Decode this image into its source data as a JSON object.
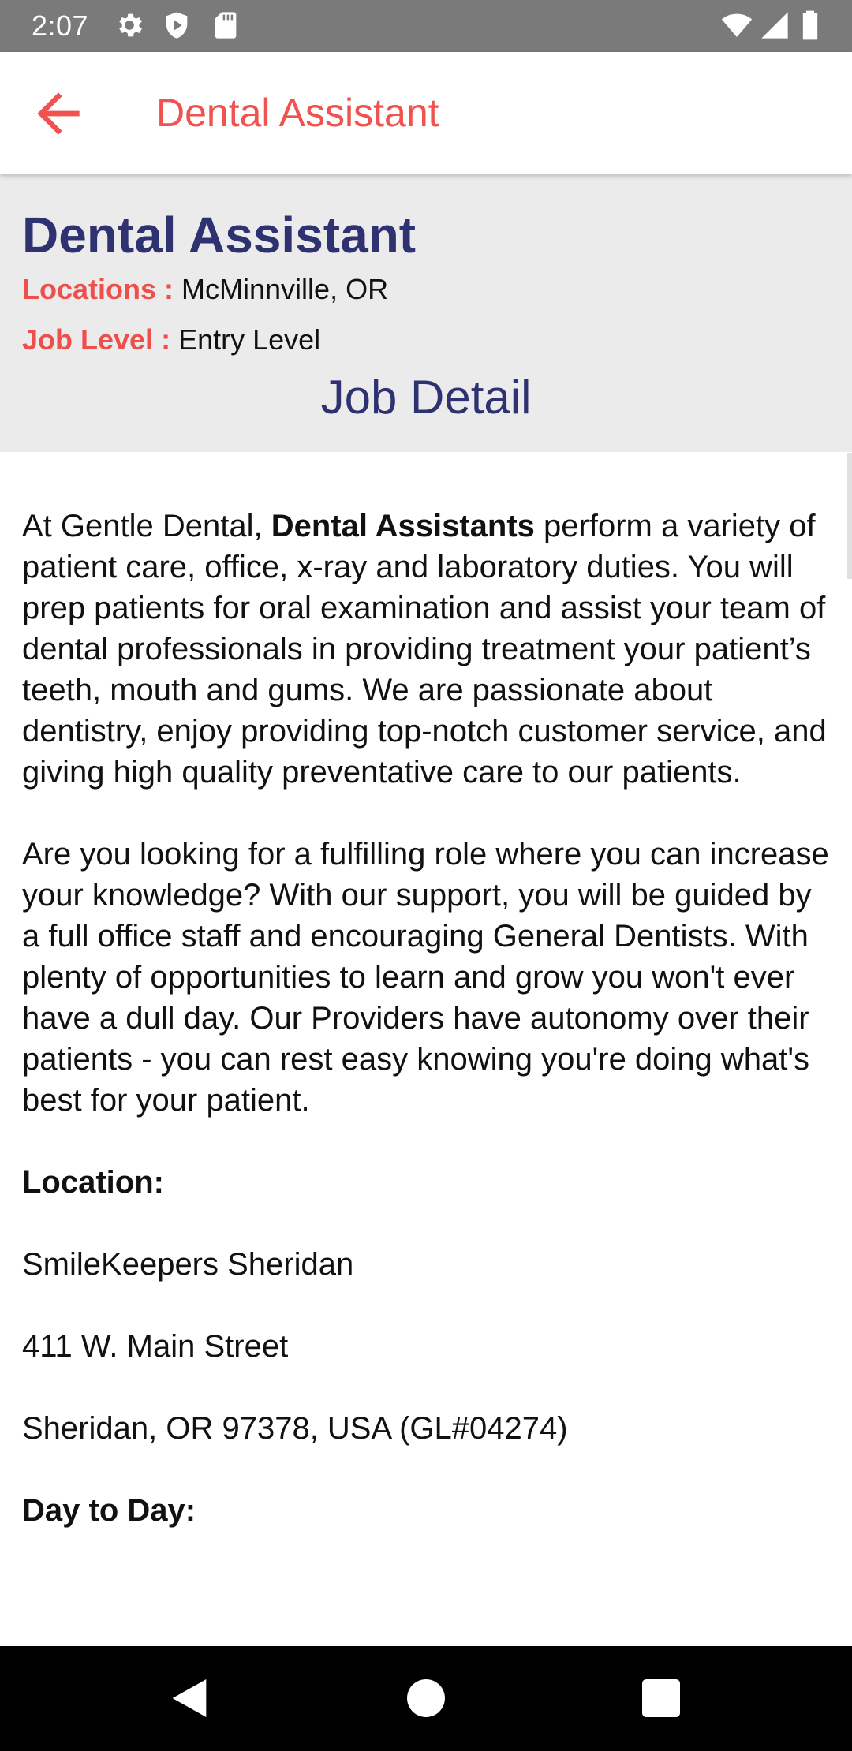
{
  "status_bar": {
    "time": "2:07",
    "icons": [
      "gear-icon",
      "shield-icon",
      "sd-card-icon",
      "wifi-icon",
      "signal-icon",
      "battery-icon"
    ]
  },
  "app_bar": {
    "back_icon": "arrow-left-icon",
    "title": "Dental Assistant"
  },
  "header": {
    "job_title": "Dental Assistant",
    "locations_label": "Locations :",
    "locations_value": "McMinnville, OR",
    "job_level_label": "Job Level :",
    "job_level_value": "Entry Level",
    "section_heading": "Job Detail"
  },
  "content": {
    "p1_before": "At Gentle Dental, ",
    "p1_bold": "Dental Assistants",
    "p1_after": " perform a variety of patient care, office, x-ray and laboratory duties. You will prep patients for oral examination and assist your team of dental professionals in providing treatment your patient’s teeth, mouth and gums. We are passionate about dentistry, enjoy providing top-notch customer service, and giving high quality preventative care to our patients.",
    "p2": "Are you looking for a fulfilling role where you can increase your knowledge? With our support, you will be guided by a full office staff and encouraging General Dentists. With plenty of opportunities to learn and grow you won't ever have a dull day. Our Providers have autonomy over their patients - you can rest easy knowing you're doing what's best for your patient.",
    "location_heading": "Location:",
    "location_name": "SmileKeepers Sheridan",
    "location_street": "411 W. Main Street",
    "location_city": "Sheridan, OR 97378, USA (GL#04274)",
    "day_heading": "Day to Day:"
  },
  "nav_bar": {
    "buttons": [
      "back-triangle-icon",
      "home-circle-icon",
      "recents-square-icon"
    ]
  },
  "colors": {
    "accent": "#f0524f",
    "title_navy": "#2e3270",
    "header_bg": "#ebebeb",
    "status_bar_bg": "#7a7a7a"
  }
}
